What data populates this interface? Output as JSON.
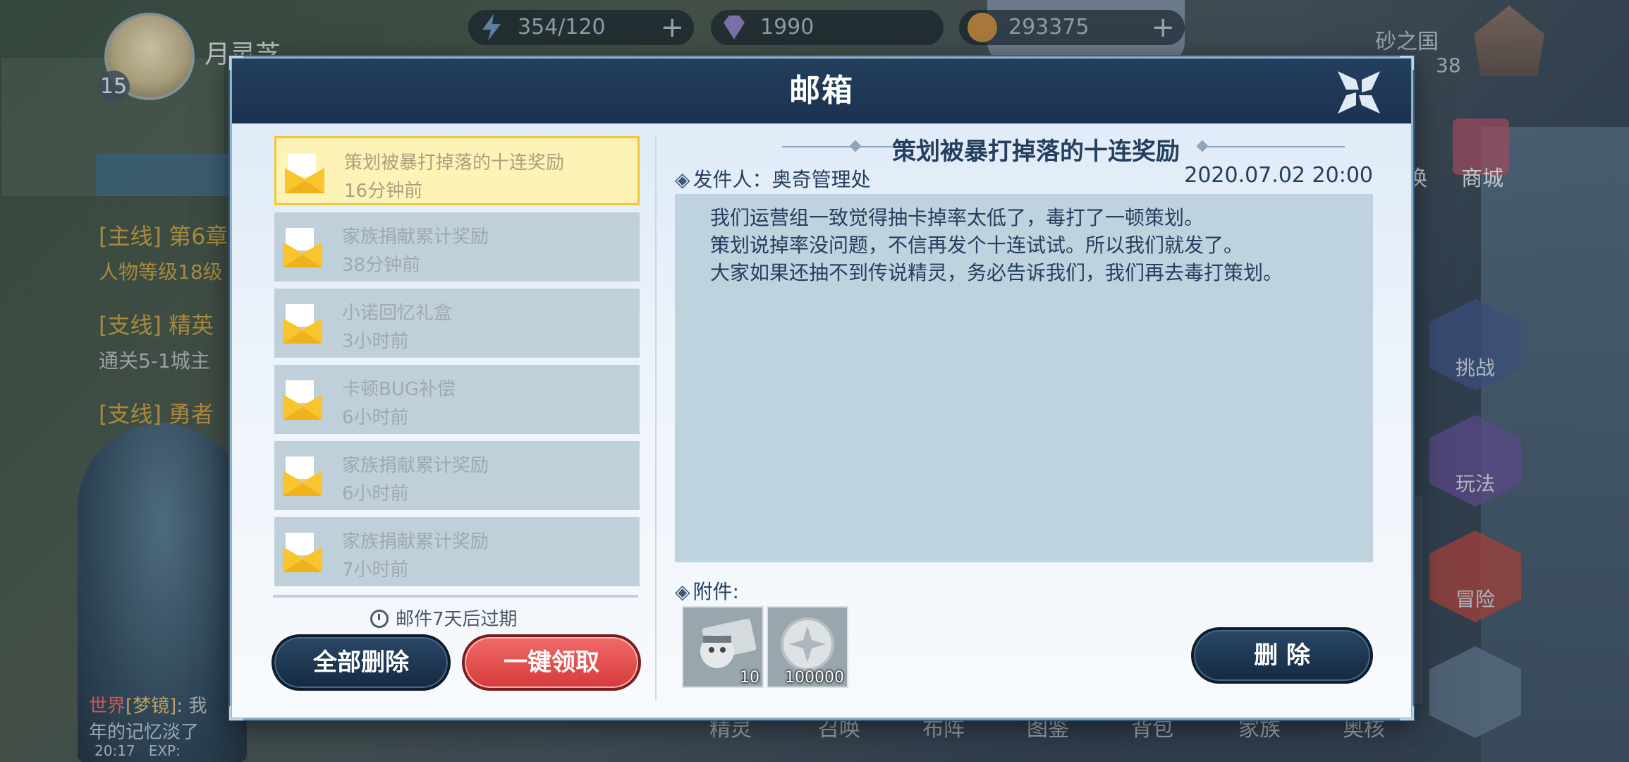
{
  "hud": {
    "player_name": "月灵芝",
    "level": "15",
    "energy": "354/120",
    "gems": "1990",
    "coins": "293375",
    "server_name": "砂之国",
    "server_sub": "38"
  },
  "background": {
    "quests": [
      {
        "tag": "[主线]",
        "title": "第6章"
      },
      {
        "tag": "[支线]",
        "title": "精英"
      },
      {
        "tag": "[支线]",
        "title": "勇者"
      }
    ],
    "quest_subs": [
      "人物等级18级",
      "通关5-1城主"
    ],
    "right_buttons": [
      "挑战",
      "玩法",
      "冒险"
    ],
    "shop_label": "商城",
    "swap_label": "换",
    "bottom_nav": [
      "精灵",
      "召唤",
      "布阵",
      "图鉴",
      "背包",
      "家族",
      "奥核"
    ],
    "chat": {
      "channel": "世界",
      "name": "[梦镜]",
      "text": "我",
      "text2": "年的记忆淡了"
    },
    "status": {
      "time": "20:17",
      "exp": "EXP:"
    }
  },
  "dialog": {
    "title": "邮箱",
    "mails": [
      {
        "subject": "策划被暴打掉落的十连奖励",
        "time": "16分钟前",
        "active": true
      },
      {
        "subject": "家族捐献累计奖励",
        "time": "38分钟前"
      },
      {
        "subject": "小诺回忆礼盒",
        "time": "3小时前"
      },
      {
        "subject": "卡顿BUG补偿",
        "time": "6小时前"
      },
      {
        "subject": "家族捐献累计奖励",
        "time": "6小时前"
      },
      {
        "subject": "家族捐献累计奖励",
        "time": "7小时前"
      }
    ],
    "expire_note": "邮件7天后过期",
    "delete_all": "全部删除",
    "claim_all": "一键领取",
    "detail": {
      "title": "策划被暴打掉落的十连奖励",
      "sender_label": "发件人：",
      "sender": "奥奇管理处",
      "date": "2020.07.02  20:00",
      "lines": [
        "我们运营组一致觉得抽卡掉率太低了，毒打了一顿策划。",
        "策划说掉率没问题，不信再发个十连试试。所以我们就发了。",
        "大家如果还抽不到传说精灵，务必告诉我们，我们再去毒打策划。"
      ],
      "attach_label": "附件:",
      "attachments": [
        {
          "icon": "summon-ticket-icon",
          "qty": "10"
        },
        {
          "icon": "silver-coin-icon",
          "qty": "100000"
        }
      ],
      "delete": "删  除"
    }
  },
  "colors": {
    "header": "#1b3350",
    "active_mail": "#fdf3b7",
    "active_border": "#f2c63a",
    "claim_button": "#e04848",
    "dark_button": "#1e3650"
  }
}
